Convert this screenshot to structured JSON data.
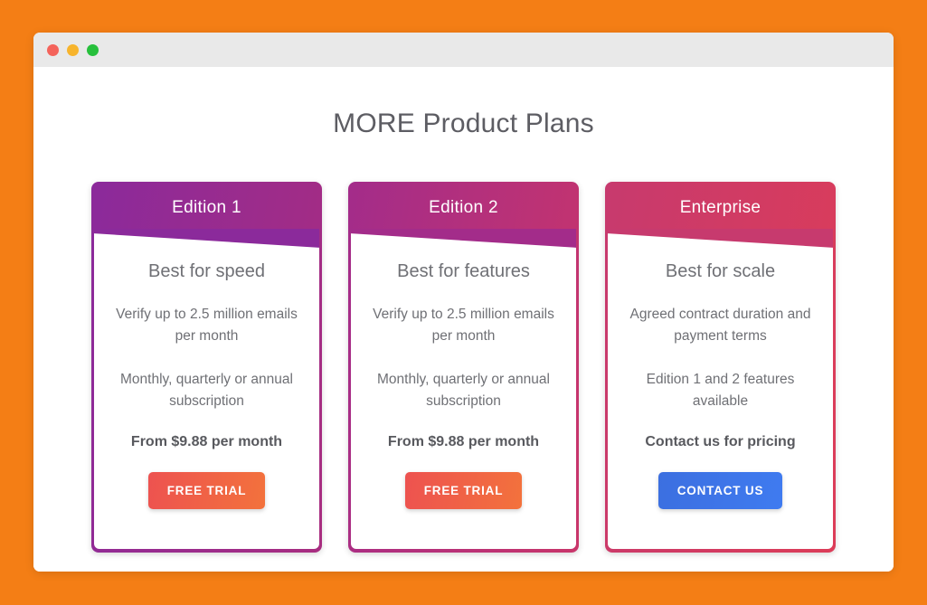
{
  "window": {
    "traffic_lights": [
      {
        "name": "close",
        "color": "#f4635b"
      },
      {
        "name": "minimize",
        "color": "#f7b42c"
      },
      {
        "name": "maximize",
        "color": "#27c03c"
      }
    ]
  },
  "page": {
    "title": "MORE Product Plans",
    "background_color": "#F47E15"
  },
  "plans": [
    {
      "id": "edition1",
      "header": "Edition 1",
      "tagline": "Best for speed",
      "feature_1": "Verify up to 2.5 million emails per month",
      "feature_2": "Monthly, quarterly or annual subscription",
      "price": "From $9.88 per month",
      "cta_label": "FREE TRIAL",
      "cta_style": "trial",
      "gradient_from": "#8B2A9B",
      "gradient_to": "#A82D80"
    },
    {
      "id": "edition2",
      "header": "Edition 2",
      "tagline": "Best for features",
      "feature_1": "Verify up to 2.5 million emails per month",
      "feature_2": "Monthly, quarterly or annual subscription",
      "price": "From $9.88 per month",
      "cta_label": "FREE TRIAL",
      "cta_style": "trial",
      "gradient_from": "#A32C8A",
      "gradient_to": "#C9356A"
    },
    {
      "id": "enterprise",
      "header": "Enterprise",
      "tagline": "Best for scale",
      "feature_1": "Agreed contract duration and payment terms",
      "feature_2": "Edition 1 and 2 features available",
      "price": "Contact us for pricing",
      "cta_label": "CONTACT US",
      "cta_style": "contact",
      "gradient_from": "#C73A6E",
      "gradient_to": "#DC3C58"
    }
  ],
  "colors": {
    "cta_trial_from": "#ED5250",
    "cta_trial_to": "#F3723C",
    "cta_contact_from": "#3C6FE0",
    "cta_contact_to": "#3F7BF0",
    "text_muted": "#6f7075",
    "text_strong": "#58595e"
  }
}
